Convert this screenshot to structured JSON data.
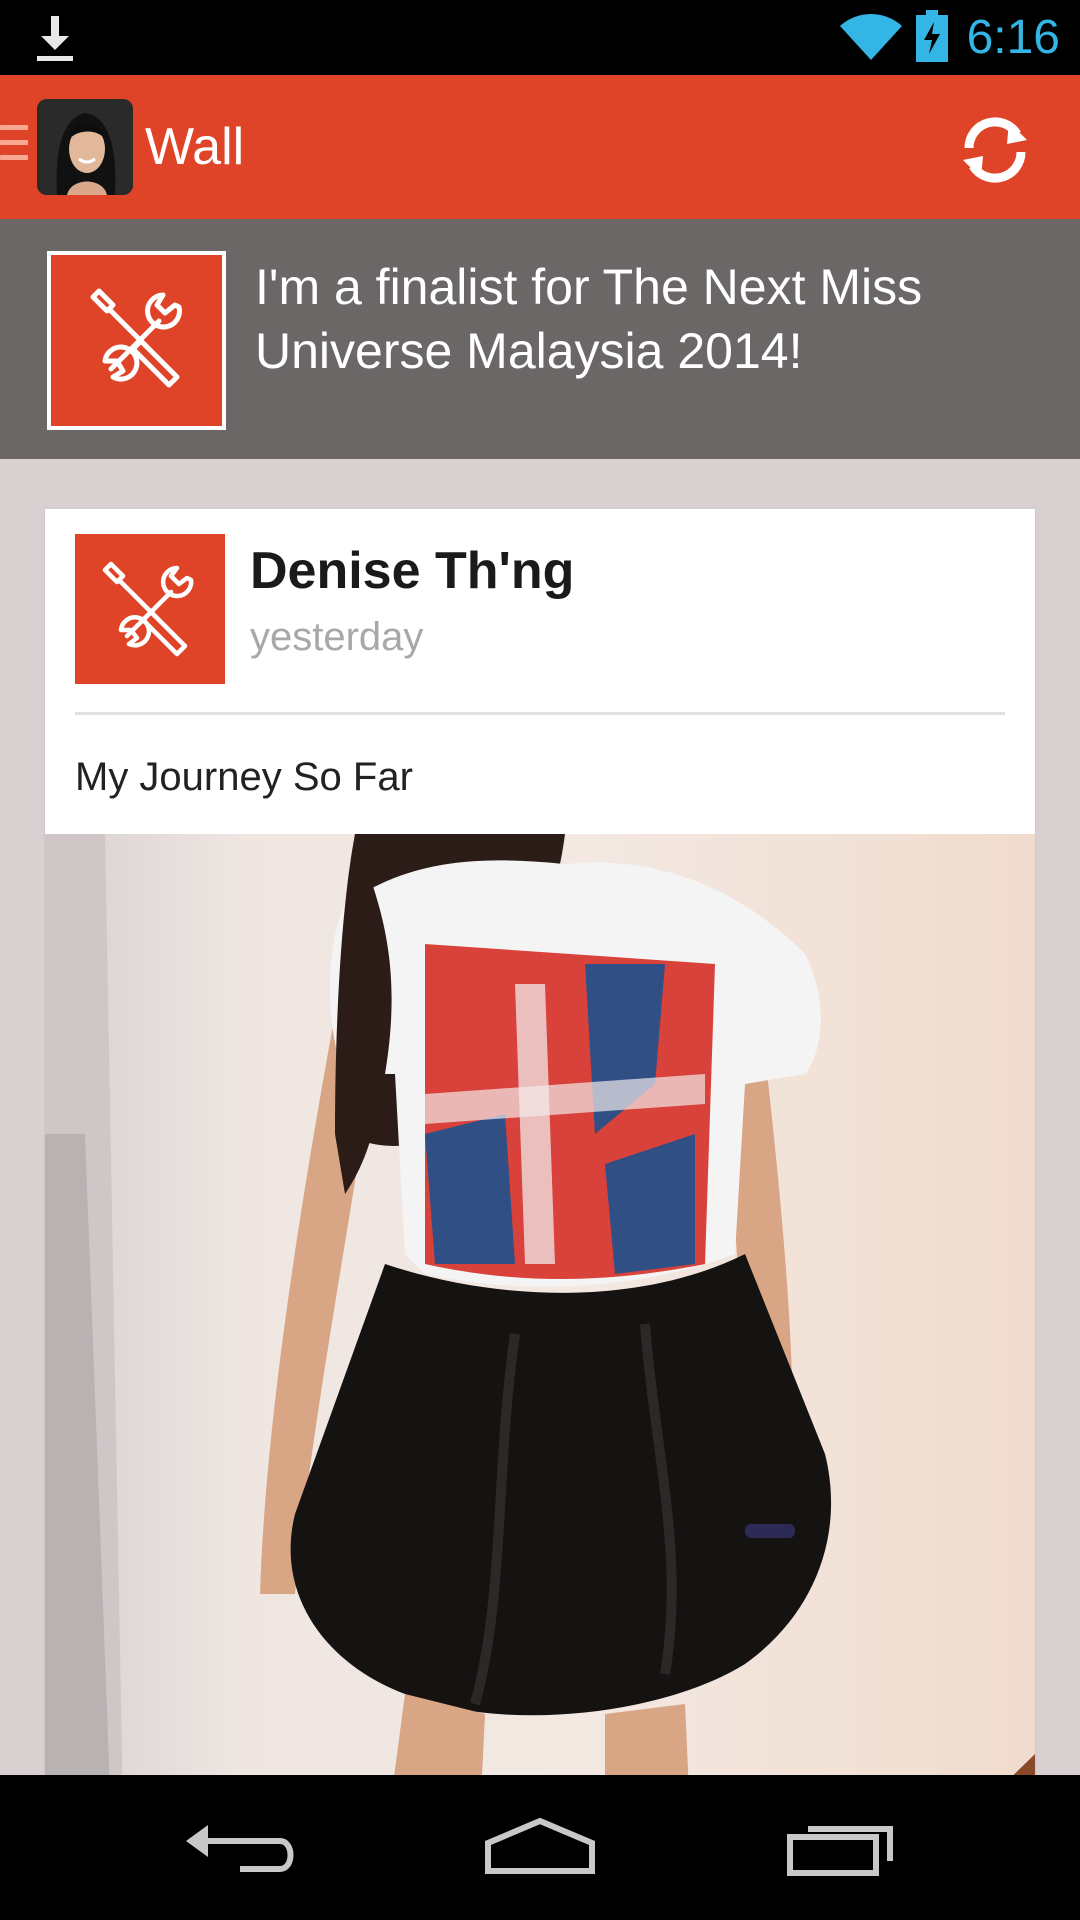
{
  "status_bar": {
    "time": "6:16",
    "icons": [
      "download-icon",
      "wifi-icon",
      "battery-charging-icon"
    ],
    "time_color": "#33b5e5"
  },
  "action_bar": {
    "title": "Wall",
    "bg_color": "#e04428",
    "icons": [
      "drawer-icon",
      "refresh-icon"
    ]
  },
  "banner": {
    "text": "I'm a finalist for The Next Miss Universe Malaysia 2014!",
    "icon": "tools-icon",
    "bg_color": "#6b6767"
  },
  "post": {
    "author": "Denise Th'ng",
    "time": "yesterday",
    "title": "My Journey So Far",
    "icon": "tools-icon"
  },
  "nav_bar": {
    "buttons": [
      "back-icon",
      "home-icon",
      "recents-icon"
    ]
  }
}
